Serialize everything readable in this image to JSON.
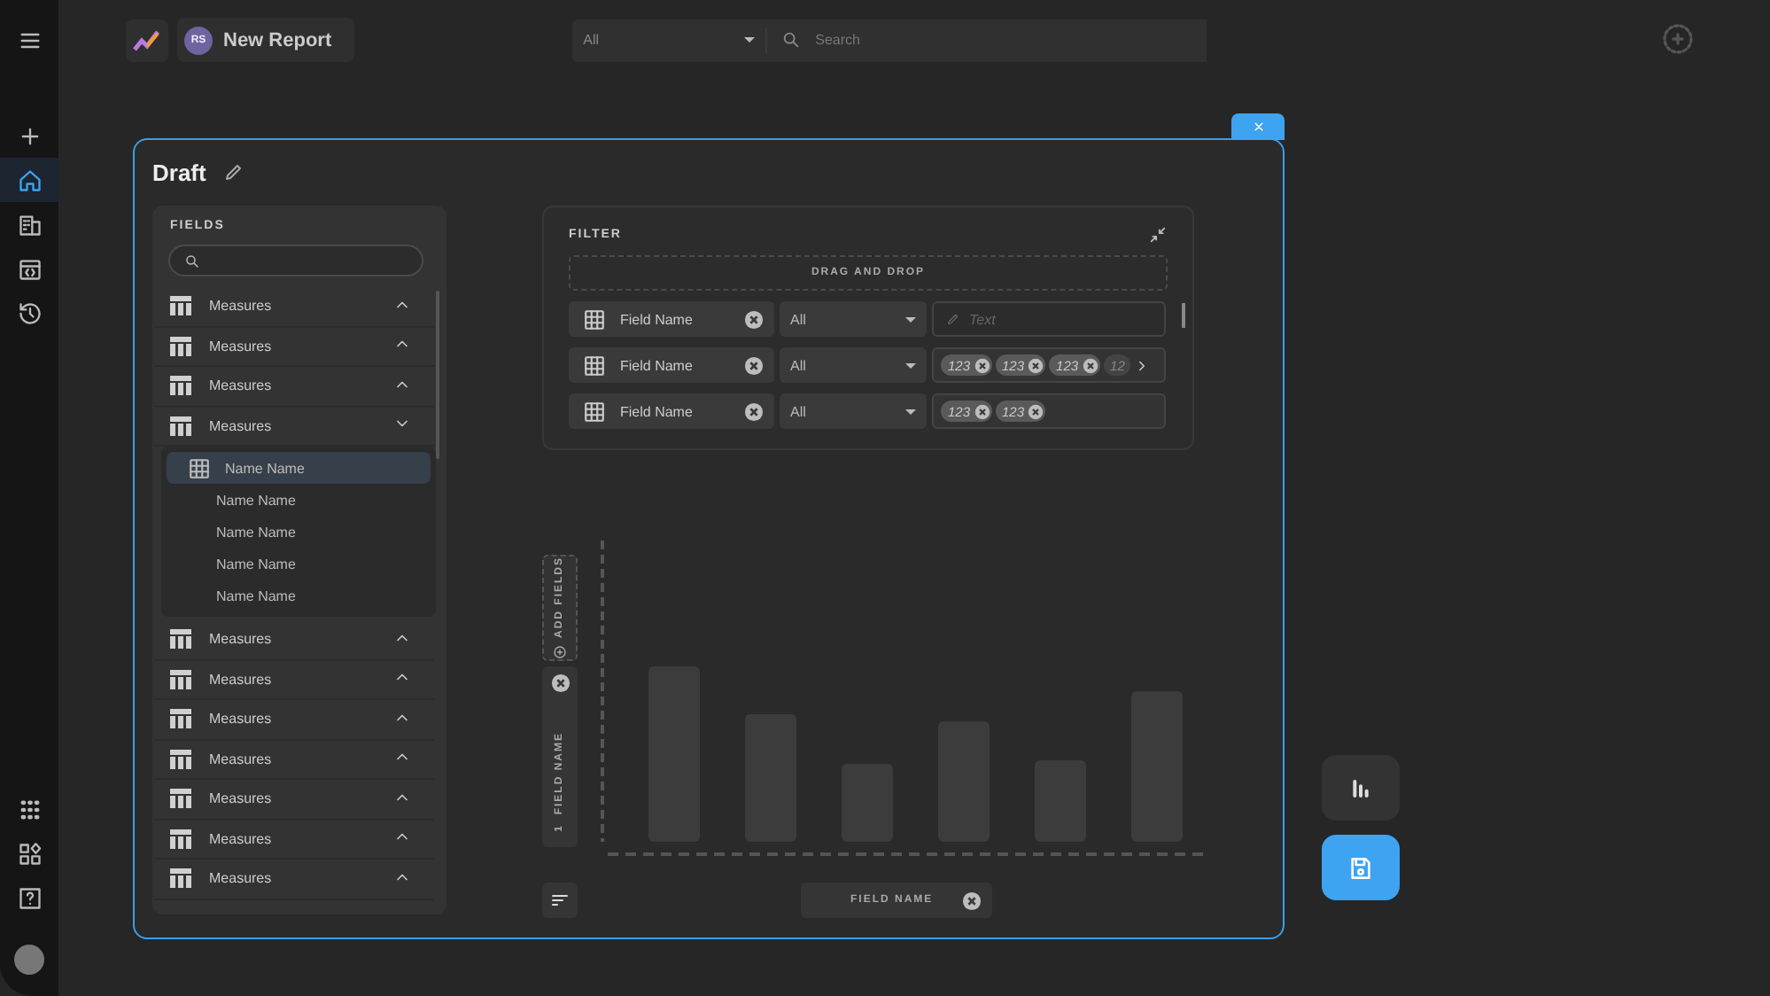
{
  "rail": {
    "top_items": [
      {
        "selected": false
      },
      {
        "selected": true
      },
      {
        "selected": false
      },
      {
        "selected": false
      },
      {
        "selected": false
      }
    ],
    "bottom_items": [
      {
        "selected": false
      },
      {
        "selected": false
      },
      {
        "selected": false
      }
    ]
  },
  "top_bar": {
    "report": {
      "initials": "RS",
      "label": "New Report"
    },
    "search": {
      "scope": "All",
      "placeholder": "Search"
    }
  },
  "modal": {
    "title": "Draft",
    "fields_panel": {
      "title": "FIELDS",
      "groups": [
        {
          "label": "Measures",
          "expanded": false
        },
        {
          "label": "Measures",
          "expanded": false
        },
        {
          "label": "Measures",
          "expanded": false
        },
        {
          "label": "Measures",
          "expanded": true,
          "children": [
            {
              "label": "Name Name",
              "selected": true
            },
            {
              "label": "Name Name",
              "selected": false
            },
            {
              "label": "Name Name",
              "selected": false
            },
            {
              "label": "Name Name",
              "selected": false
            },
            {
              "label": "Name Name",
              "selected": false
            }
          ]
        },
        {
          "label": "Measures",
          "expanded": false
        },
        {
          "label": "Measures",
          "expanded": false
        },
        {
          "label": "Measures",
          "expanded": false
        },
        {
          "label": "Measures",
          "expanded": false
        },
        {
          "label": "Measures",
          "expanded": false
        },
        {
          "label": "Measures",
          "expanded": false
        },
        {
          "label": "Measures",
          "expanded": false
        }
      ]
    },
    "filter": {
      "title": "FILTER",
      "drop_zone": "DRAG AND DROP",
      "rows": [
        {
          "field": "Field Name",
          "operator": "All",
          "kind": "text",
          "placeholder": "Text"
        },
        {
          "field": "Field Name",
          "operator": "All",
          "kind": "chips",
          "chips": [
            "123",
            "123",
            "123"
          ],
          "overflow_chip": "12"
        },
        {
          "field": "Field Name",
          "operator": "All",
          "kind": "chips",
          "chips": [
            "123",
            "123"
          ]
        }
      ]
    },
    "chart": {
      "add_fields": "ADD FIELDS",
      "y_field": {
        "index": "1",
        "label": "FIELD NAME"
      },
      "x_field": "FIELD NAME"
    }
  }
}
